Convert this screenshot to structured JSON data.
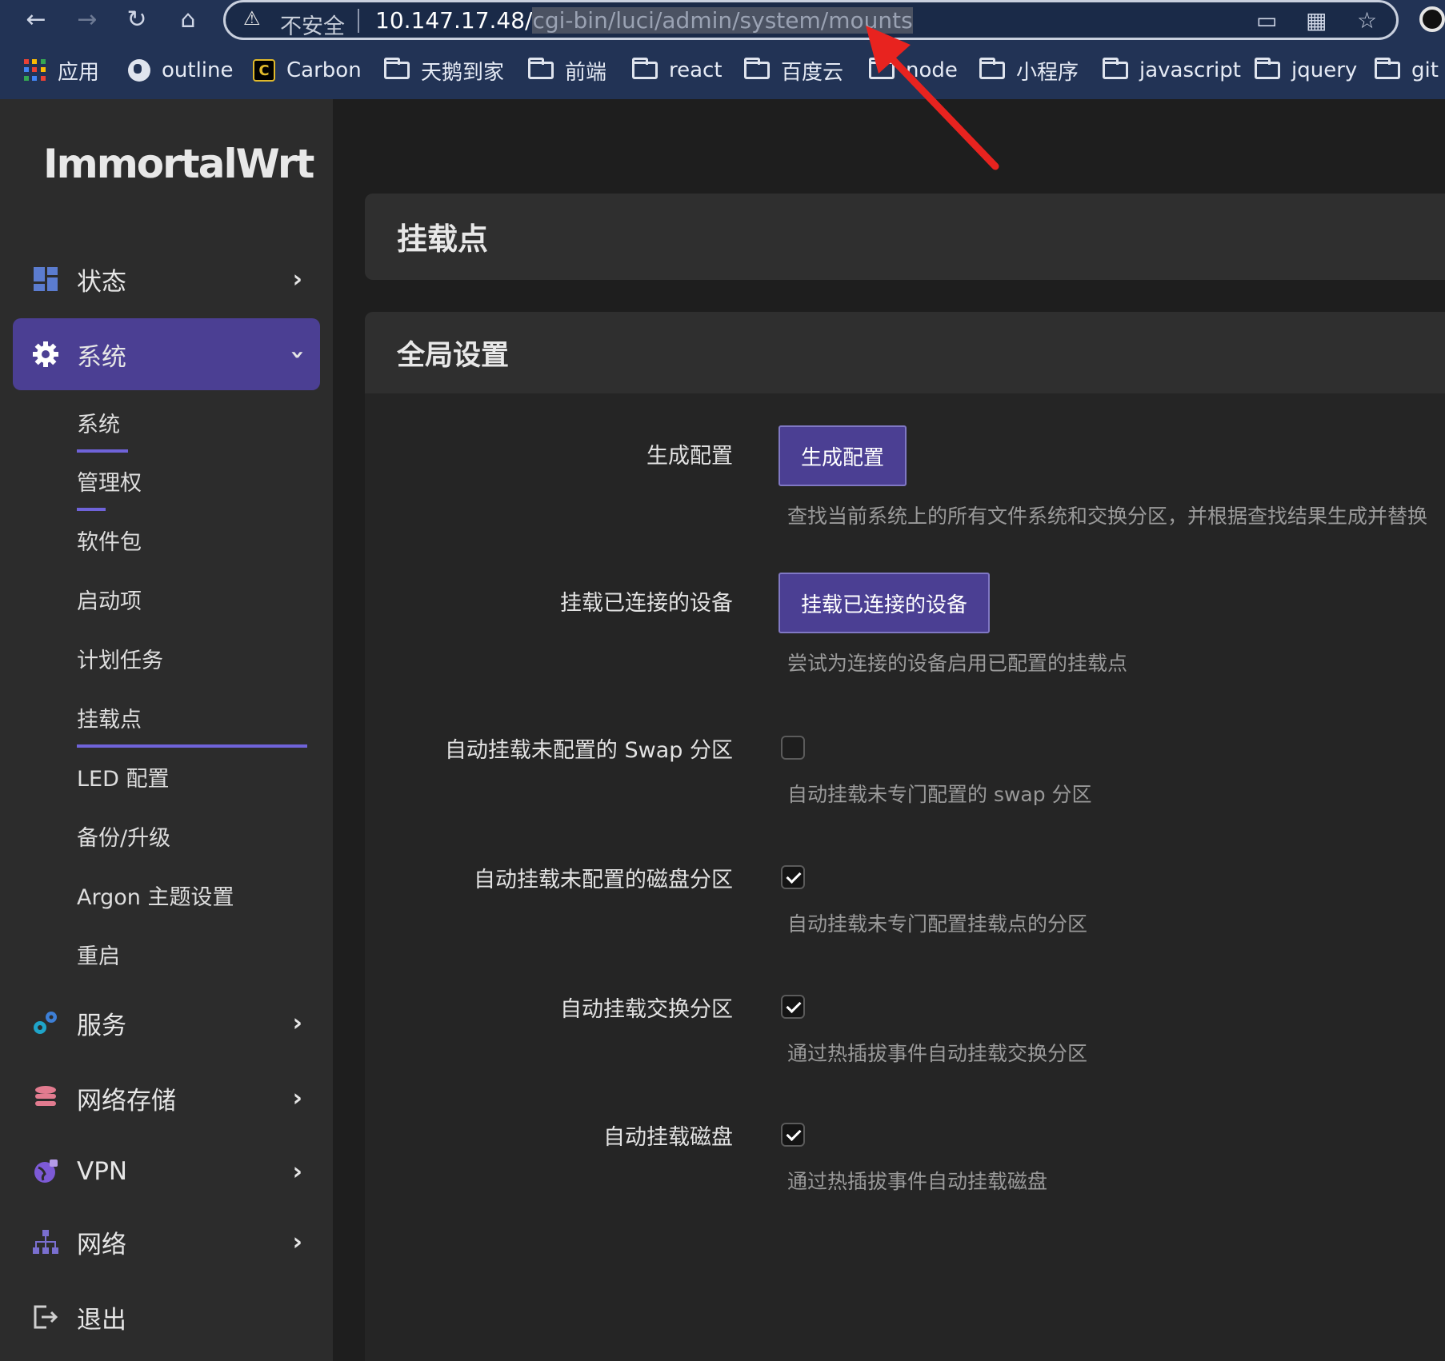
{
  "browser": {
    "security_label": "不安全",
    "url_host": "10.147.17.48/",
    "url_path": "cgi-bin/luci/admin/system/mounts",
    "bookmarks": [
      {
        "label": "应用",
        "icon": "apps-grid-icon"
      },
      {
        "label": "outline",
        "icon": "globe-icon"
      },
      {
        "label": "Carbon",
        "icon": "carbon-icon"
      },
      {
        "label": "天鹅到家",
        "icon": "folder-icon"
      },
      {
        "label": "前端",
        "icon": "folder-icon"
      },
      {
        "label": "react",
        "icon": "folder-icon"
      },
      {
        "label": "百度云",
        "icon": "folder-icon"
      },
      {
        "label": "node",
        "icon": "folder-icon"
      },
      {
        "label": "小程序",
        "icon": "folder-icon"
      },
      {
        "label": "javascript",
        "icon": "folder-icon"
      },
      {
        "label": "jquery",
        "icon": "folder-icon"
      },
      {
        "label": "git",
        "icon": "folder-icon"
      }
    ],
    "annotation_color": "#e8231f"
  },
  "sidebar": {
    "logo": "ImmortalWrt",
    "menu": [
      {
        "label": "状态",
        "icon": "dashboard-icon"
      },
      {
        "label": "系统",
        "icon": "gear-icon",
        "active": true
      },
      {
        "label": "服务",
        "icon": "services-icon"
      },
      {
        "label": "网络存储",
        "icon": "storage-icon"
      },
      {
        "label": "VPN",
        "icon": "vpn-icon"
      },
      {
        "label": "网络",
        "icon": "network-icon"
      },
      {
        "label": "退出",
        "icon": "logout-icon"
      }
    ],
    "submenu": [
      {
        "label": "系统"
      },
      {
        "label": "管理权"
      },
      {
        "label": "软件包"
      },
      {
        "label": "启动项"
      },
      {
        "label": "计划任务"
      },
      {
        "label": "挂载点",
        "active": true
      },
      {
        "label": "LED 配置"
      },
      {
        "label": "备份/升级"
      },
      {
        "label": "Argon 主题设置"
      },
      {
        "label": "重启"
      }
    ],
    "accent": "#4b3f93"
  },
  "main": {
    "page_title": "挂载点",
    "section_title": "全局设置",
    "rows": [
      {
        "label": "生成配置",
        "type": "button",
        "button": "生成配置",
        "desc": "查找当前系统上的所有文件系统和交换分区，并根据查找结果生成并替换"
      },
      {
        "label": "挂载已连接的设备",
        "type": "button",
        "button": "挂载已连接的设备",
        "desc": "尝试为连接的设备启用已配置的挂载点"
      },
      {
        "label": "自动挂载未配置的 Swap 分区",
        "type": "checkbox",
        "checked": false,
        "desc": "自动挂载未专门配置的 swap 分区"
      },
      {
        "label": "自动挂载未配置的磁盘分区",
        "type": "checkbox",
        "checked": true,
        "desc": "自动挂载未专门配置挂载点的分区"
      },
      {
        "label": "自动挂载交换分区",
        "type": "checkbox",
        "checked": true,
        "desc": "通过热插拔事件自动挂载交换分区"
      },
      {
        "label": "自动挂载磁盘",
        "type": "checkbox",
        "checked": true,
        "desc": "通过热插拔事件自动挂载磁盘"
      }
    ]
  }
}
